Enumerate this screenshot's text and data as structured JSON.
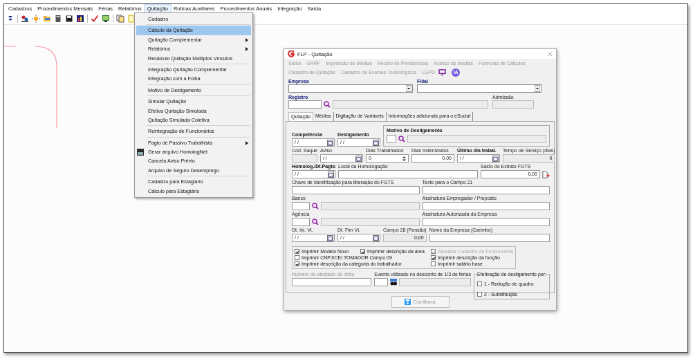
{
  "menubar": [
    {
      "label": "Cadastros",
      "selected": false
    },
    {
      "label": "Procedimentos Mensais",
      "selected": false
    },
    {
      "label": "Férias",
      "selected": false
    },
    {
      "label": "Relatórios",
      "selected": false
    },
    {
      "label": "Quitação",
      "selected": true
    },
    {
      "label": "Rotinas Auxiliares",
      "selected": false
    },
    {
      "label": "Procedimentos Anuais",
      "selected": false
    },
    {
      "label": "Integração",
      "selected": false
    },
    {
      "label": "Saída",
      "selected": false
    }
  ],
  "dropdown": {
    "groups": [
      [
        {
          "label": "Cadastro",
          "selected": false,
          "submenu": false,
          "has_icon": false
        }
      ],
      [
        {
          "label": "Cálculo da Quitação",
          "selected": true,
          "submenu": false,
          "has_icon": false
        },
        {
          "label": "Quitação Complementar",
          "selected": false,
          "submenu": true,
          "has_icon": false
        },
        {
          "label": "Relatórios",
          "selected": false,
          "submenu": true,
          "has_icon": false
        },
        {
          "label": "Recálculo Quitação Múltiplos Vínculos",
          "selected": false,
          "submenu": false,
          "has_icon": false
        }
      ],
      [
        {
          "label": "Integração Quitação Complementar",
          "selected": false,
          "submenu": false,
          "has_icon": false
        },
        {
          "label": "Integração com a Folha",
          "selected": false,
          "submenu": false,
          "has_icon": false
        }
      ],
      [
        {
          "label": "Motivo de Desligamento",
          "selected": false,
          "submenu": false,
          "has_icon": false
        }
      ],
      [
        {
          "label": "Simular Quitação",
          "selected": false,
          "submenu": false,
          "has_icon": false
        },
        {
          "label": "Efetiva Quitação Simulada",
          "selected": false,
          "submenu": false,
          "has_icon": false
        },
        {
          "label": "Quitação Simulada Coletiva",
          "selected": false,
          "submenu": false,
          "has_icon": false
        }
      ],
      [
        {
          "label": "Reintegração de Funcionários",
          "selected": false,
          "submenu": false,
          "has_icon": false
        }
      ],
      [
        {
          "label": "Pagto de Passivo Trabalhista",
          "selected": false,
          "submenu": true,
          "has_icon": false
        },
        {
          "label": "Gerar arquivo HomologNet",
          "selected": false,
          "submenu": false,
          "has_icon": true
        },
        {
          "label": "Cancela Aviso Prévio",
          "selected": false,
          "submenu": false,
          "has_icon": false
        },
        {
          "label": "Arquivo de Seguro Desemprego",
          "selected": false,
          "submenu": false,
          "has_icon": false
        }
      ],
      [
        {
          "label": "Cadastro para Estagiário",
          "selected": false,
          "submenu": false,
          "has_icon": false
        },
        {
          "label": "Cálculo para Estagiário",
          "selected": false,
          "submenu": false,
          "has_icon": false
        }
      ]
    ]
  },
  "dialog": {
    "title": "FLP - Quitação",
    "menu_rows": [
      [
        "Saída",
        "GRRF",
        "Impressão de Médias",
        "Recibo de Pensionistas",
        "Acesso as médias",
        "Fórmulas de Cálculos"
      ],
      [
        "Cadastro de Quitação",
        "Cadastro de Exames Toxicológicos",
        "LGPD"
      ]
    ],
    "ia_badge": "IA",
    "empresa": "Empresa",
    "filial": "Filial",
    "registro": "Registro",
    "admissao": "Admissão",
    "tabs": [
      {
        "label": "Quitação",
        "selected": true
      },
      {
        "label": "Médias",
        "selected": false
      },
      {
        "label": "Digitação de Variáveis",
        "selected": false
      },
      {
        "label": "Informações adicionais para o eSocial",
        "selected": false
      }
    ],
    "field_lines": [
      {
        "fields": [
          {
            "label": "Competência",
            "kind": "date",
            "value": "/ /",
            "bold": true
          },
          {
            "label": "Desligamento",
            "kind": "date",
            "value": "/ /",
            "bold": true
          },
          {
            "label": "Motivo de Desligamento",
            "kind": "group-lookup",
            "bold": true
          }
        ]
      },
      {
        "fields": [
          {
            "label": "Cód. Saque",
            "kind": "code",
            "bold": false
          },
          {
            "label": "Aviso",
            "kind": "date",
            "value": "/ /",
            "bold": false
          },
          {
            "label": "Dias Trabalhados",
            "kind": "spin",
            "value": "0",
            "bold": false
          },
          {
            "label": "Dias Indenizados",
            "kind": "number",
            "value": "0,00",
            "bold": false
          },
          {
            "label": "Último dia trabal.",
            "kind": "date",
            "value": "/ /",
            "bold": true
          },
          {
            "label": "Tempo de Serviço (dias)",
            "kind": "readonly-wide",
            "value": "0",
            "bold": false
          }
        ]
      },
      {
        "fields": [
          {
            "label": "Homolog./Dt.Pagto",
            "kind": "date",
            "value": "/ /",
            "bold": true
          },
          {
            "label": "Local da Homologação",
            "kind": "text",
            "bold": false
          },
          {
            "label": "Saldo do Extrato FGTS",
            "kind": "amount",
            "value": "0,00",
            "bold": false
          }
        ]
      },
      {
        "fields": [
          {
            "label": "Chave de identificação para liberação do FGTS",
            "kind": "text",
            "bold": false
          },
          {
            "label": "Texto para o Campo 21",
            "kind": "text",
            "bold": false
          }
        ]
      },
      {
        "fields": [
          {
            "label": "Banco",
            "kind": "lookup",
            "bold": false
          },
          {
            "label": "Assinatura Empregador / Preposto",
            "kind": "text",
            "bold": false
          }
        ]
      },
      {
        "fields": [
          {
            "label": "Agência",
            "kind": "lookup",
            "bold": false
          },
          {
            "label": "Assinatura Autorizada da Empresa",
            "kind": "text",
            "bold": false
          }
        ]
      },
      {
        "fields": [
          {
            "label": "Dt. Ini. Vt.",
            "kind": "date",
            "value": "/ /",
            "bold": false
          },
          {
            "label": "Dt. Fim Vt.",
            "kind": "date",
            "value": "/ /",
            "bold": false
          },
          {
            "label": "Campo 28 (Pensão)",
            "kind": "readonly-number",
            "value": "0,00",
            "bold": false
          },
          {
            "label": "Nome da Empresa (Carimbo)",
            "kind": "text",
            "bold": false
          }
        ]
      }
    ],
    "checkbox_columns": [
      [
        {
          "label": "Imprimir Modelo Novo",
          "checked": true,
          "disabled": false
        },
        {
          "label": "Imprimir CNPJ/CEI TOMADOR Campo 09",
          "checked": false,
          "disabled": false
        },
        {
          "label": "Imprimir descrição da categoria do trabalhador",
          "checked": true,
          "disabled": false
        }
      ],
      [
        {
          "label": "Imprimir descrição da área",
          "checked": true,
          "disabled": false
        }
      ],
      [
        {
          "label": "Atualizar Cadastro de Funcionários",
          "checked": true,
          "disabled": true
        },
        {
          "label": "Imprimir descrição da função",
          "checked": true,
          "disabled": false
        },
        {
          "label": "Imprimir salário base",
          "checked": false,
          "disabled": false
        }
      ]
    ],
    "atestado": {
      "label": "Número do atestado de óbito",
      "disabled": true
    },
    "evento": {
      "label": "Evento utilizado no desconto de 1/3 de férias"
    },
    "efetivacao": {
      "title": "Efetivação de desligamento por:",
      "options": [
        {
          "label": "1 - Redução de quadro",
          "checked": false
        },
        {
          "label": "2 - Substituição",
          "checked": false
        }
      ]
    },
    "confirm": {
      "label": "Confirma",
      "disabled": true
    }
  }
}
